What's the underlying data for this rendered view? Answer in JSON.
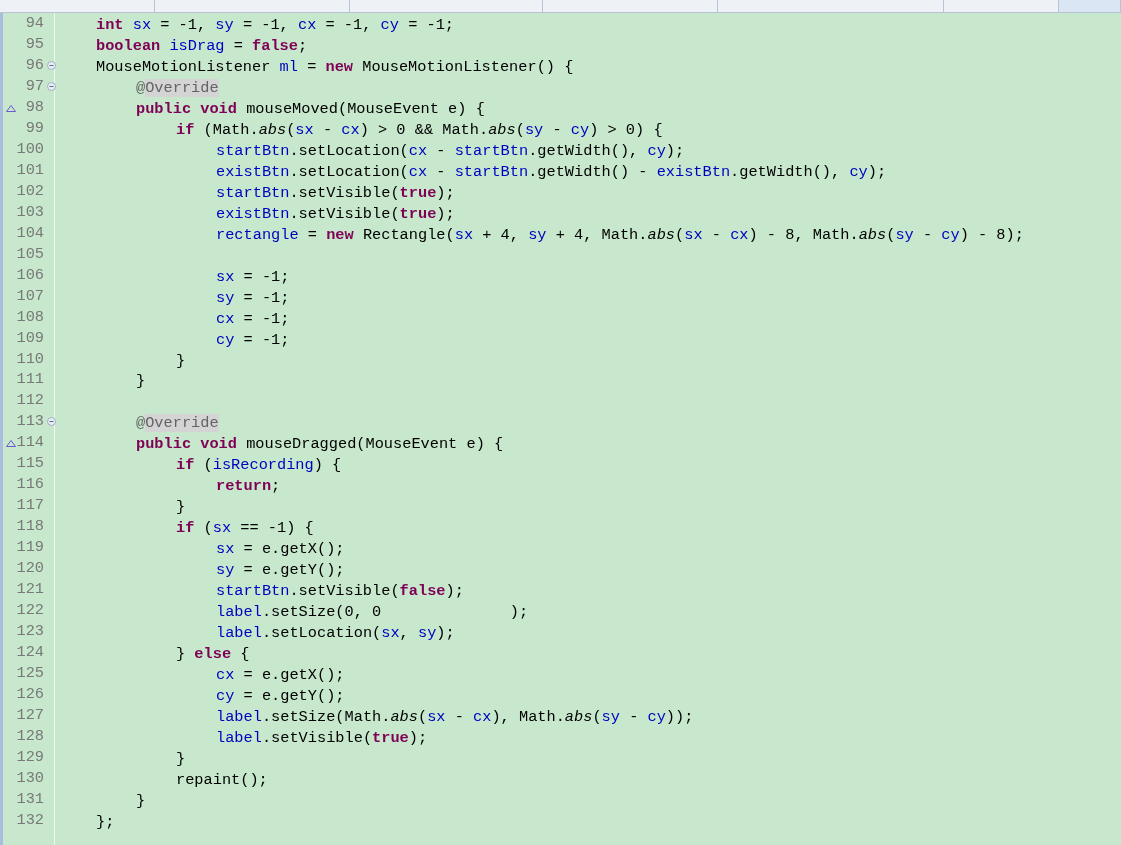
{
  "editor": {
    "lines": [
      {
        "number": "94",
        "fold": false,
        "override": false,
        "tokens": [
          {
            "t": "int ",
            "kind": "kw"
          },
          {
            "t": "sx",
            "kind": "field"
          },
          {
            "t": " = -1, ",
            "kind": "plain"
          },
          {
            "t": "sy",
            "kind": "field"
          },
          {
            "t": " = -1, ",
            "kind": "plain"
          },
          {
            "t": "cx",
            "kind": "field"
          },
          {
            "t": " = -1, ",
            "kind": "plain"
          },
          {
            "t": "cy",
            "kind": "field"
          },
          {
            "t": " = -1;",
            "kind": "plain"
          }
        ]
      },
      {
        "number": "95",
        "fold": false,
        "override": false,
        "tokens": [
          {
            "t": "boolean ",
            "kind": "kw"
          },
          {
            "t": "isDrag",
            "kind": "field"
          },
          {
            "t": " = ",
            "kind": "plain"
          },
          {
            "t": "false",
            "kind": "kw"
          },
          {
            "t": ";",
            "kind": "plain"
          }
        ]
      },
      {
        "number": "96",
        "fold": true,
        "override": false,
        "tokens": [
          {
            "t": "MouseMotionListener ",
            "kind": "plain"
          },
          {
            "t": "ml",
            "kind": "field"
          },
          {
            "t": " = ",
            "kind": "plain"
          },
          {
            "t": "new",
            "kind": "kw"
          },
          {
            "t": " MouseMotionListener() {",
            "kind": "plain"
          }
        ],
        "children": [
          {
            "number": "97",
            "fold": true,
            "override": false,
            "tokens": [
              {
                "t": "@",
                "kind": "annotation"
              },
              {
                "t": "Override",
                "kind": "highlight"
              }
            ]
          },
          {
            "number": "98",
            "fold": false,
            "override": true,
            "tokens": [
              {
                "t": "public ",
                "kind": "kw"
              },
              {
                "t": "void ",
                "kind": "kw"
              },
              {
                "t": "mouseMoved(MouseEvent e) {",
                "kind": "plain"
              }
            ],
            "children": [
              {
                "number": "99",
                "fold": false,
                "override": false,
                "tokens": [
                  {
                    "t": "if ",
                    "kind": "kw"
                  },
                  {
                    "t": "(Math.",
                    "kind": "plain"
                  },
                  {
                    "t": "abs",
                    "kind": "static"
                  },
                  {
                    "t": "(",
                    "kind": "plain"
                  },
                  {
                    "t": "sx",
                    "kind": "field"
                  },
                  {
                    "t": " - ",
                    "kind": "plain"
                  },
                  {
                    "t": "cx",
                    "kind": "field"
                  },
                  {
                    "t": ") > 0 && Math.",
                    "kind": "plain"
                  },
                  {
                    "t": "abs",
                    "kind": "static"
                  },
                  {
                    "t": "(",
                    "kind": "plain"
                  },
                  {
                    "t": "sy",
                    "kind": "field"
                  },
                  {
                    "t": " - ",
                    "kind": "plain"
                  },
                  {
                    "t": "cy",
                    "kind": "field"
                  },
                  {
                    "t": ") > 0) {",
                    "kind": "plain"
                  }
                ],
                "children": [
                  {
                    "number": "100",
                    "fold": false,
                    "override": false,
                    "tokens": [
                      {
                        "t": "startBtn",
                        "kind": "field"
                      },
                      {
                        "t": ".setLocation(",
                        "kind": "plain"
                      },
                      {
                        "t": "cx",
                        "kind": "field"
                      },
                      {
                        "t": " - ",
                        "kind": "plain"
                      },
                      {
                        "t": "startBtn",
                        "kind": "field"
                      },
                      {
                        "t": ".getWidth(), ",
                        "kind": "plain"
                      },
                      {
                        "t": "cy",
                        "kind": "field"
                      },
                      {
                        "t": ");",
                        "kind": "plain"
                      }
                    ]
                  },
                  {
                    "number": "101",
                    "fold": false,
                    "override": false,
                    "tokens": [
                      {
                        "t": "existBtn",
                        "kind": "field"
                      },
                      {
                        "t": ".setLocation(",
                        "kind": "plain"
                      },
                      {
                        "t": "cx",
                        "kind": "field"
                      },
                      {
                        "t": " - ",
                        "kind": "plain"
                      },
                      {
                        "t": "startBtn",
                        "kind": "field"
                      },
                      {
                        "t": ".getWidth() - ",
                        "kind": "plain"
                      },
                      {
                        "t": "existBtn",
                        "kind": "field"
                      },
                      {
                        "t": ".getWidth(), ",
                        "kind": "plain"
                      },
                      {
                        "t": "cy",
                        "kind": "field"
                      },
                      {
                        "t": ");",
                        "kind": "plain"
                      }
                    ]
                  },
                  {
                    "number": "102",
                    "fold": false,
                    "override": false,
                    "tokens": [
                      {
                        "t": "startBtn",
                        "kind": "field"
                      },
                      {
                        "t": ".setVisible(",
                        "kind": "plain"
                      },
                      {
                        "t": "true",
                        "kind": "kw"
                      },
                      {
                        "t": ");",
                        "kind": "plain"
                      }
                    ]
                  },
                  {
                    "number": "103",
                    "fold": false,
                    "override": false,
                    "tokens": [
                      {
                        "t": "existBtn",
                        "kind": "field"
                      },
                      {
                        "t": ".setVisible(",
                        "kind": "plain"
                      },
                      {
                        "t": "true",
                        "kind": "kw"
                      },
                      {
                        "t": ");",
                        "kind": "plain"
                      }
                    ]
                  },
                  {
                    "number": "104",
                    "fold": false,
                    "override": false,
                    "tokens": [
                      {
                        "t": "rectangle",
                        "kind": "field"
                      },
                      {
                        "t": " = ",
                        "kind": "plain"
                      },
                      {
                        "t": "new",
                        "kind": "kw"
                      },
                      {
                        "t": " Rectangle(",
                        "kind": "plain"
                      },
                      {
                        "t": "sx",
                        "kind": "field"
                      },
                      {
                        "t": " + 4, ",
                        "kind": "plain"
                      },
                      {
                        "t": "sy",
                        "kind": "field"
                      },
                      {
                        "t": " + 4, Math.",
                        "kind": "plain"
                      },
                      {
                        "t": "abs",
                        "kind": "static"
                      },
                      {
                        "t": "(",
                        "kind": "plain"
                      },
                      {
                        "t": "sx",
                        "kind": "field"
                      },
                      {
                        "t": " - ",
                        "kind": "plain"
                      },
                      {
                        "t": "cx",
                        "kind": "field"
                      },
                      {
                        "t": ") - 8, Math.",
                        "kind": "plain"
                      },
                      {
                        "t": "abs",
                        "kind": "static"
                      },
                      {
                        "t": "(",
                        "kind": "plain"
                      },
                      {
                        "t": "sy",
                        "kind": "field"
                      },
                      {
                        "t": " - ",
                        "kind": "plain"
                      },
                      {
                        "t": "cy",
                        "kind": "field"
                      },
                      {
                        "t": ") - 8);",
                        "kind": "plain"
                      }
                    ]
                  },
                  {
                    "number": "105",
                    "fold": false,
                    "override": false
                  },
                  {
                    "number": "106",
                    "fold": false,
                    "override": false,
                    "tokens": [
                      {
                        "t": "sx",
                        "kind": "field"
                      },
                      {
                        "t": " = -1;",
                        "kind": "plain"
                      }
                    ]
                  },
                  {
                    "number": "107",
                    "fold": false,
                    "override": false,
                    "tokens": [
                      {
                        "t": "sy",
                        "kind": "field"
                      },
                      {
                        "t": " = -1;",
                        "kind": "plain"
                      }
                    ]
                  },
                  {
                    "number": "108",
                    "fold": false,
                    "override": false,
                    "tokens": [
                      {
                        "t": "cx",
                        "kind": "field"
                      },
                      {
                        "t": " = -1;",
                        "kind": "plain"
                      }
                    ]
                  },
                  {
                    "number": "109",
                    "fold": false,
                    "override": false,
                    "tokens": [
                      {
                        "t": "cy",
                        "kind": "field"
                      },
                      {
                        "t": " = -1;",
                        "kind": "plain"
                      }
                    ]
                  }
                ]
              },
              {
                "number": "110",
                "fold": false,
                "override": false,
                "tokens": [
                  {
                    "t": "}",
                    "kind": "plain"
                  }
                ]
              }
            ]
          },
          {
            "number": "111",
            "fold": false,
            "override": false,
            "tokens": [
              {
                "t": "}",
                "kind": "plain"
              }
            ]
          },
          {
            "number": "112",
            "fold": false,
            "override": false
          },
          {
            "number": "113",
            "fold": true,
            "override": false,
            "tokens": [
              {
                "t": "@",
                "kind": "annotation"
              },
              {
                "t": "Override",
                "kind": "highlight"
              }
            ]
          },
          {
            "number": "114",
            "fold": false,
            "override": true,
            "tokens": [
              {
                "t": "public ",
                "kind": "kw"
              },
              {
                "t": "void ",
                "kind": "kw"
              },
              {
                "t": "mouseDragged(MouseEvent e) {",
                "kind": "plain"
              }
            ],
            "children": [
              {
                "number": "115",
                "fold": false,
                "override": false,
                "tokens": [
                  {
                    "t": "if ",
                    "kind": "kw"
                  },
                  {
                    "t": "(",
                    "kind": "plain"
                  },
                  {
                    "t": "isRecording",
                    "kind": "field"
                  },
                  {
                    "t": ") {",
                    "kind": "plain"
                  }
                ],
                "children": [
                  {
                    "number": "116",
                    "fold": false,
                    "override": false,
                    "tokens": [
                      {
                        "t": "return",
                        "kind": "kw"
                      },
                      {
                        "t": ";",
                        "kind": "plain"
                      }
                    ]
                  }
                ]
              },
              {
                "number": "117",
                "fold": false,
                "override": false,
                "tokens": [
                  {
                    "t": "}",
                    "kind": "plain"
                  }
                ]
              },
              {
                "number": "118",
                "fold": false,
                "override": false,
                "tokens": [
                  {
                    "t": "if ",
                    "kind": "kw"
                  },
                  {
                    "t": "(",
                    "kind": "plain"
                  },
                  {
                    "t": "sx",
                    "kind": "field"
                  },
                  {
                    "t": " == -1) {",
                    "kind": "plain"
                  }
                ],
                "children": [
                  {
                    "number": "119",
                    "fold": false,
                    "override": false,
                    "tokens": [
                      {
                        "t": "sx",
                        "kind": "field"
                      },
                      {
                        "t": " = e.getX();",
                        "kind": "plain"
                      }
                    ]
                  },
                  {
                    "number": "120",
                    "fold": false,
                    "override": false,
                    "tokens": [
                      {
                        "t": "sy",
                        "kind": "field"
                      },
                      {
                        "t": " = e.getY();",
                        "kind": "plain"
                      }
                    ]
                  },
                  {
                    "number": "121",
                    "fold": false,
                    "override": false,
                    "tokens": [
                      {
                        "t": "startBtn",
                        "kind": "field"
                      },
                      {
                        "t": ".setVisible(",
                        "kind": "plain"
                      },
                      {
                        "t": "false",
                        "kind": "kw"
                      },
                      {
                        "t": ");",
                        "kind": "plain"
                      }
                    ]
                  },
                  {
                    "number": "122",
                    "fold": false,
                    "override": false,
                    "tokens": [
                      {
                        "t": "label",
                        "kind": "field"
                      },
                      {
                        "t": ".setSize(0, 0              );",
                        "kind": "plain"
                      }
                    ]
                  },
                  {
                    "number": "123",
                    "fold": false,
                    "override": false,
                    "tokens": [
                      {
                        "t": "label",
                        "kind": "field"
                      },
                      {
                        "t": ".setLocation(",
                        "kind": "plain"
                      },
                      {
                        "t": "sx",
                        "kind": "field"
                      },
                      {
                        "t": ", ",
                        "kind": "plain"
                      },
                      {
                        "t": "sy",
                        "kind": "field"
                      },
                      {
                        "t": ");",
                        "kind": "plain"
                      }
                    ]
                  }
                ]
              },
              {
                "number": "124",
                "fold": false,
                "override": false,
                "tokens": [
                  {
                    "t": "} ",
                    "kind": "plain"
                  },
                  {
                    "t": "else",
                    "kind": "kw"
                  },
                  {
                    "t": " {",
                    "kind": "plain"
                  }
                ],
                "children": [
                  {
                    "number": "125",
                    "fold": false,
                    "override": false,
                    "tokens": [
                      {
                        "t": "cx",
                        "kind": "field"
                      },
                      {
                        "t": " = e.getX();",
                        "kind": "plain"
                      }
                    ]
                  },
                  {
                    "number": "126",
                    "fold": false,
                    "override": false,
                    "tokens": [
                      {
                        "t": "cy",
                        "kind": "field"
                      },
                      {
                        "t": " = e.getY();",
                        "kind": "plain"
                      }
                    ]
                  },
                  {
                    "number": "127",
                    "fold": false,
                    "override": false,
                    "tokens": [
                      {
                        "t": "label",
                        "kind": "field"
                      },
                      {
                        "t": ".setSize(Math.",
                        "kind": "plain"
                      },
                      {
                        "t": "abs",
                        "kind": "static"
                      },
                      {
                        "t": "(",
                        "kind": "plain"
                      },
                      {
                        "t": "sx",
                        "kind": "field"
                      },
                      {
                        "t": " - ",
                        "kind": "plain"
                      },
                      {
                        "t": "cx",
                        "kind": "field"
                      },
                      {
                        "t": "), Math.",
                        "kind": "plain"
                      },
                      {
                        "t": "abs",
                        "kind": "static"
                      },
                      {
                        "t": "(",
                        "kind": "plain"
                      },
                      {
                        "t": "sy",
                        "kind": "field"
                      },
                      {
                        "t": " - ",
                        "kind": "plain"
                      },
                      {
                        "t": "cy",
                        "kind": "field"
                      },
                      {
                        "t": "));",
                        "kind": "plain"
                      }
                    ]
                  },
                  {
                    "number": "128",
                    "fold": false,
                    "override": false,
                    "tokens": [
                      {
                        "t": "label",
                        "kind": "field"
                      },
                      {
                        "t": ".setVisible(",
                        "kind": "plain"
                      },
                      {
                        "t": "true",
                        "kind": "kw"
                      },
                      {
                        "t": ");",
                        "kind": "plain"
                      }
                    ]
                  }
                ]
              },
              {
                "number": "129",
                "fold": false,
                "override": false,
                "tokens": [
                  {
                    "t": "}",
                    "kind": "plain"
                  }
                ]
              },
              {
                "number": "130",
                "fold": false,
                "override": false,
                "tokens": [
                  {
                    "t": "repaint();",
                    "kind": "plain"
                  }
                ]
              }
            ]
          },
          {
            "number": "131",
            "fold": false,
            "override": false,
            "tokens": [
              {
                "t": "}",
                "kind": "plain"
              }
            ]
          }
        ]
      },
      {
        "number": "132",
        "fold": false,
        "override": false,
        "tokens": [
          {
            "t": "};",
            "kind": "plain"
          }
        ]
      }
    ]
  }
}
